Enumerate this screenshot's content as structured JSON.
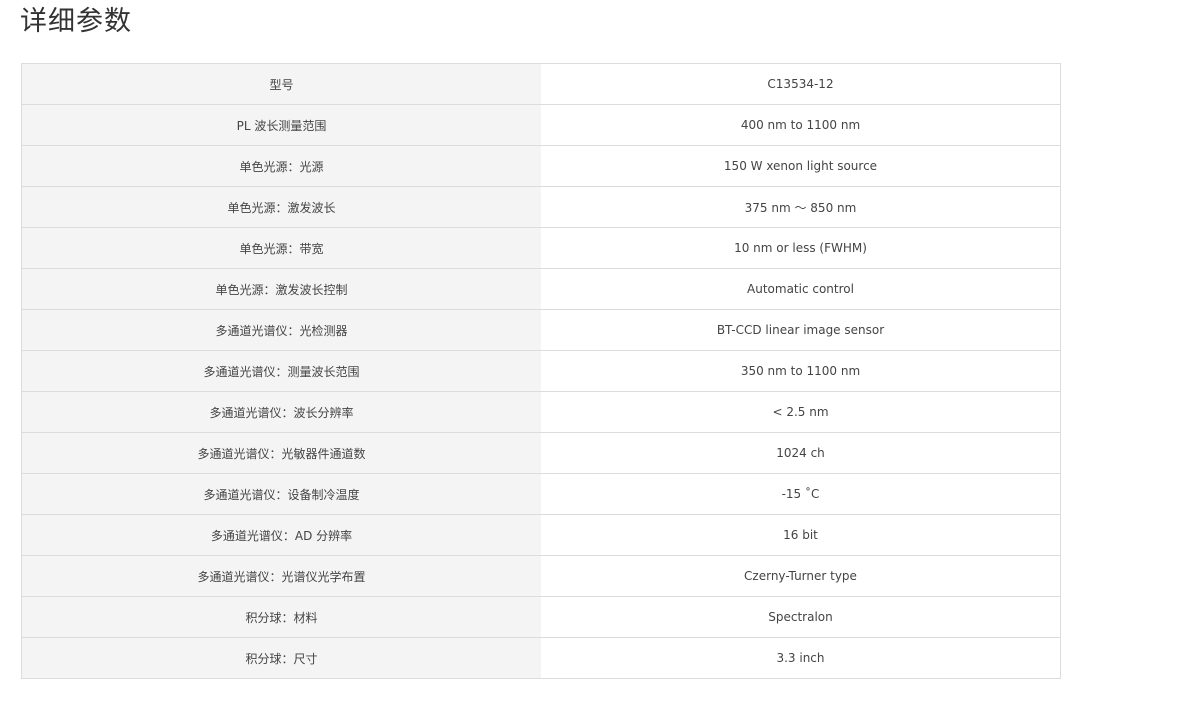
{
  "page": {
    "title": "详细参数"
  },
  "specs": [
    {
      "param": "型号",
      "value": "C13534-12"
    },
    {
      "param": "PL 波长测量范围",
      "value": "400 nm to 1100 nm"
    },
    {
      "param": "单色光源：光源",
      "value": "150 W xenon light source"
    },
    {
      "param": "单色光源：激发波长",
      "value": "375 nm ～ 850 nm"
    },
    {
      "param": "单色光源：带宽",
      "value": "10 nm or less (FWHM)"
    },
    {
      "param": "单色光源：激发波长控制",
      "value": "Automatic control"
    },
    {
      "param": "多通道光谱仪：光检测器",
      "value": "BT-CCD linear image sensor"
    },
    {
      "param": "多通道光谱仪：测量波长范围",
      "value": "350 nm to 1100 nm"
    },
    {
      "param": "多通道光谱仪：波长分辨率",
      "value": "< 2.5 nm"
    },
    {
      "param": "多通道光谱仪：光敏器件通道数",
      "value": "1024 ch"
    },
    {
      "param": "多通道光谱仪：设备制冷温度",
      "value": "-15 ˚C"
    },
    {
      "param": "多通道光谱仪：AD 分辨率",
      "value": "16 bit"
    },
    {
      "param": "多通道光谱仪：光谱仪光学布置",
      "value": "Czerny-Turner type"
    },
    {
      "param": "积分球：材料",
      "value": "Spectralon"
    },
    {
      "param": "积分球：尺寸",
      "value": "3.3 inch"
    }
  ]
}
